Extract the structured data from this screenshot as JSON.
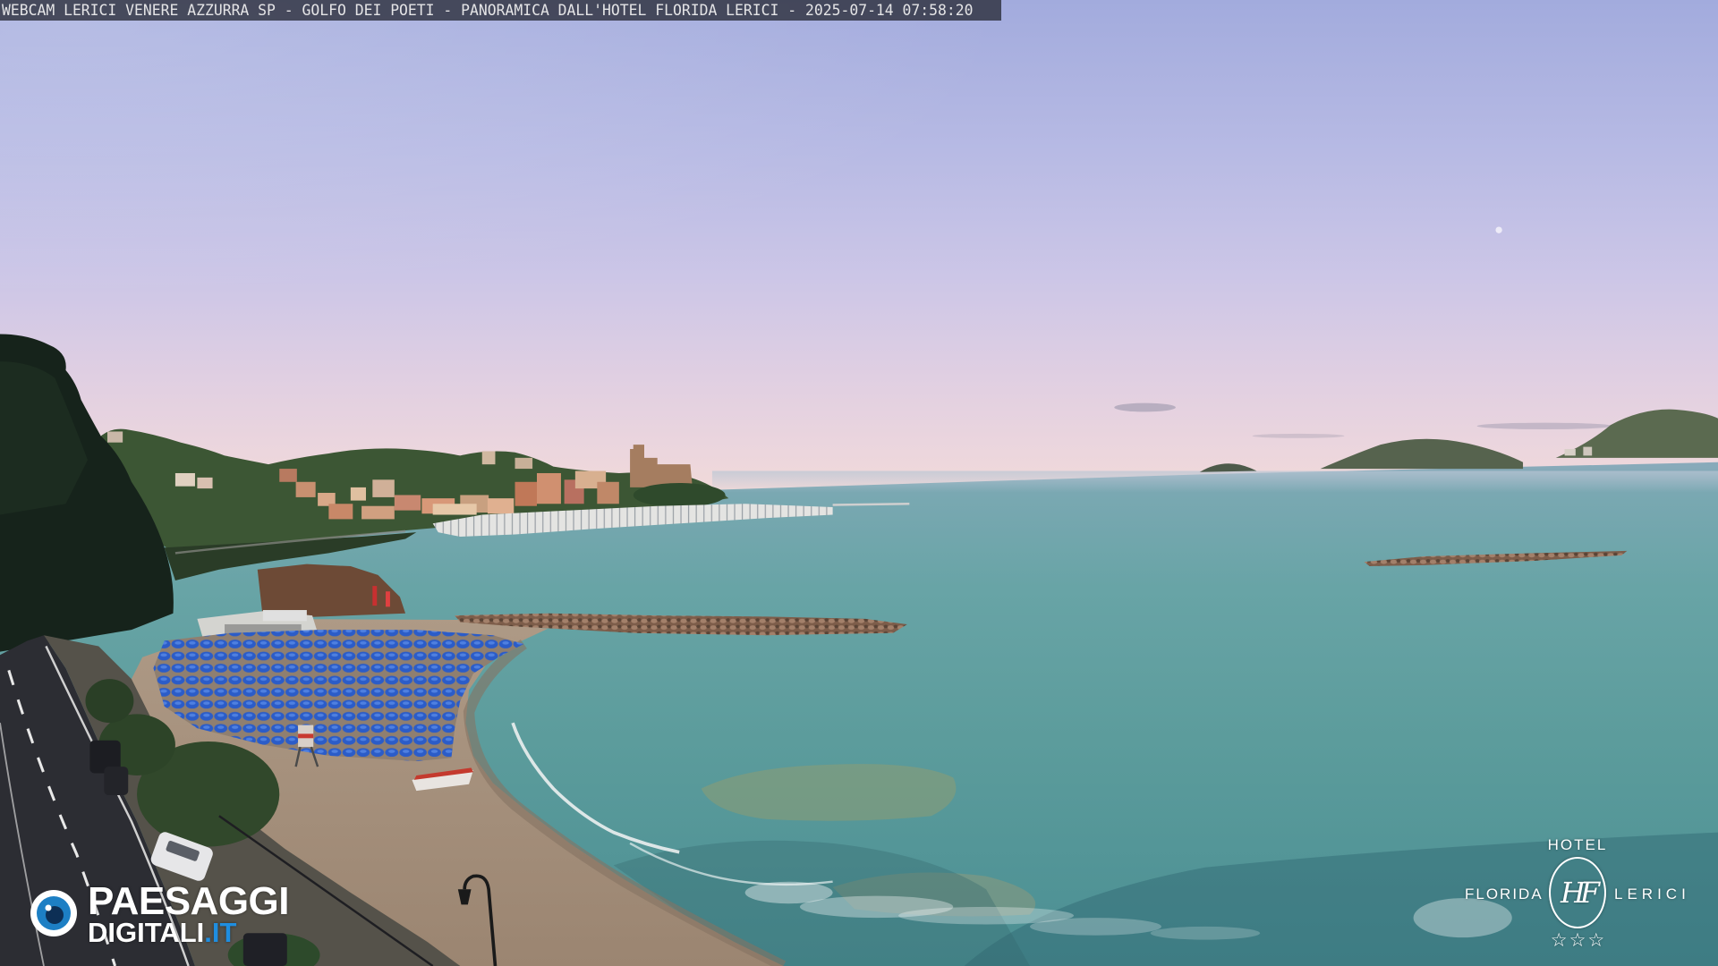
{
  "webcam_banner": {
    "text": "WEBCAM LERICI VENERE AZZURRA SP - GOLFO DEI POETI - PANORAMICA DALL'HOTEL FLORIDA LERICI - 2025-07-14 07:58:20"
  },
  "watermark_paesaggi": {
    "icon": "eye-icon",
    "line1": "PAESAGGI",
    "line2": "DIGITALI",
    "line2_suffix": ".IT",
    "accent_color": "#1f8ee0"
  },
  "watermark_hotel": {
    "icon": "hotel-monogram-icon",
    "top_label": "HOTEL",
    "left_label": "FLORIDA",
    "right_label": "LERICI",
    "monogram": "HF",
    "stars": "☆☆☆"
  },
  "colors": {
    "sky_top": "#a2abdd",
    "sky_horizon": "#f2dbd7",
    "sea": "#5c9c9c",
    "umbrellas": "#2b5cc8"
  }
}
